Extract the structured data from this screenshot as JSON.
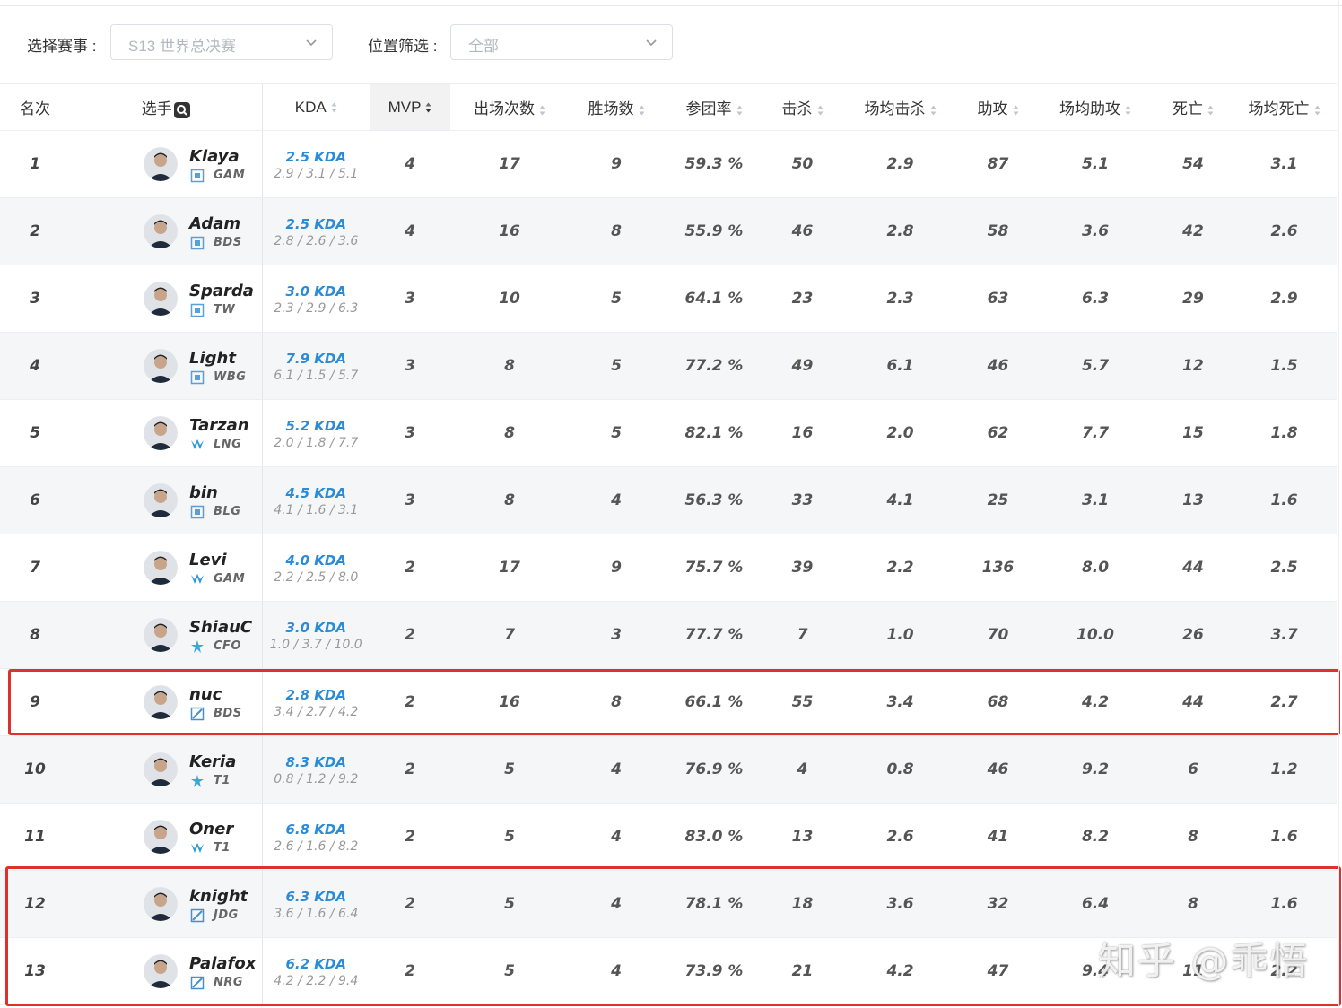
{
  "filters": {
    "event_label": "选择赛事 :",
    "event_value": "S13 世界总决赛",
    "position_label": "位置筛选 :",
    "position_value": "全部"
  },
  "columns": {
    "rank": "名次",
    "player": "选手",
    "kda": "KDA",
    "mvp": "MVP",
    "games": "出场次数",
    "wins": "胜场数",
    "kp": "参团率",
    "kills": "击杀",
    "avg_kills": "场均击杀",
    "assists": "助攻",
    "avg_assists": "场均助攻",
    "deaths": "死亡",
    "avg_deaths": "场均死亡"
  },
  "colors": {
    "accent": "#2a8bd6",
    "highlight": "#e0302b",
    "row_alt": "#f5f6f8"
  },
  "rows": [
    {
      "rank": "1",
      "name": "Kiaya",
      "team": "GAM",
      "team_icon": "square-logo-icon",
      "kda": "2.5 KDA",
      "kda_detail": "2.9 / 3.1 / 5.1",
      "mvp": "4",
      "games": "17",
      "wins": "9",
      "kp": "59.3 %",
      "kills": "50",
      "avg_kills": "2.9",
      "assists": "87",
      "avg_assists": "5.1",
      "deaths": "54",
      "avg_deaths": "3.1"
    },
    {
      "rank": "2",
      "name": "Adam",
      "team": "BDS",
      "team_icon": "square-logo-icon",
      "kda": "2.5 KDA",
      "kda_detail": "2.8 / 2.6 / 3.6",
      "mvp": "4",
      "games": "16",
      "wins": "8",
      "kp": "55.9 %",
      "kills": "46",
      "avg_kills": "2.8",
      "assists": "58",
      "avg_assists": "3.6",
      "deaths": "42",
      "avg_deaths": "2.6"
    },
    {
      "rank": "3",
      "name": "Sparda",
      "team": "TW",
      "team_icon": "square-logo-icon",
      "kda": "3.0 KDA",
      "kda_detail": "2.3 / 2.9 / 6.3",
      "mvp": "3",
      "games": "10",
      "wins": "5",
      "kp": "64.1 %",
      "kills": "23",
      "avg_kills": "2.3",
      "assists": "63",
      "avg_assists": "6.3",
      "deaths": "29",
      "avg_deaths": "2.9"
    },
    {
      "rank": "4",
      "name": "Light",
      "team": "WBG",
      "team_icon": "square-logo-icon",
      "kda": "7.9 KDA",
      "kda_detail": "6.1 / 1.5 / 5.7",
      "mvp": "3",
      "games": "8",
      "wins": "5",
      "kp": "77.2 %",
      "kills": "49",
      "avg_kills": "6.1",
      "assists": "46",
      "avg_assists": "5.7",
      "deaths": "12",
      "avg_deaths": "1.5"
    },
    {
      "rank": "5",
      "name": "Tarzan",
      "team": "LNG",
      "team_icon": "wings-logo-icon",
      "kda": "5.2 KDA",
      "kda_detail": "2.0 / 1.8 / 7.7",
      "mvp": "3",
      "games": "8",
      "wins": "5",
      "kp": "82.1 %",
      "kills": "16",
      "avg_kills": "2.0",
      "assists": "62",
      "avg_assists": "7.7",
      "deaths": "15",
      "avg_deaths": "1.8"
    },
    {
      "rank": "6",
      "name": "bin",
      "team": "BLG",
      "team_icon": "square-logo-icon",
      "kda": "4.5 KDA",
      "kda_detail": "4.1 / 1.6 / 3.1",
      "mvp": "3",
      "games": "8",
      "wins": "4",
      "kp": "56.3 %",
      "kills": "33",
      "avg_kills": "4.1",
      "assists": "25",
      "avg_assists": "3.1",
      "deaths": "13",
      "avg_deaths": "1.6"
    },
    {
      "rank": "7",
      "name": "Levi",
      "team": "GAM",
      "team_icon": "wings-logo-icon",
      "kda": "4.0 KDA",
      "kda_detail": "2.2 / 2.5 / 8.0",
      "mvp": "2",
      "games": "17",
      "wins": "9",
      "kp": "75.7 %",
      "kills": "39",
      "avg_kills": "2.2",
      "assists": "136",
      "avg_assists": "8.0",
      "deaths": "44",
      "avg_deaths": "2.5"
    },
    {
      "rank": "8",
      "name": "ShiauC",
      "team": "CFO",
      "team_icon": "star-logo-icon",
      "kda": "3.0 KDA",
      "kda_detail": "1.0 / 3.7 / 10.0",
      "mvp": "2",
      "games": "7",
      "wins": "3",
      "kp": "77.7 %",
      "kills": "7",
      "avg_kills": "1.0",
      "assists": "70",
      "avg_assists": "10.0",
      "deaths": "26",
      "avg_deaths": "3.7"
    },
    {
      "rank": "9",
      "name": "nuc",
      "team": "BDS",
      "team_icon": "slash-logo-icon",
      "kda": "2.8 KDA",
      "kda_detail": "3.4 / 2.7 / 4.2",
      "mvp": "2",
      "games": "16",
      "wins": "8",
      "kp": "66.1 %",
      "kills": "55",
      "avg_kills": "3.4",
      "assists": "68",
      "avg_assists": "4.2",
      "deaths": "44",
      "avg_deaths": "2.7"
    },
    {
      "rank": "10",
      "name": "Keria",
      "team": "T1",
      "team_icon": "star-logo-icon",
      "kda": "8.3 KDA",
      "kda_detail": "0.8 / 1.2 / 9.2",
      "mvp": "2",
      "games": "5",
      "wins": "4",
      "kp": "76.9 %",
      "kills": "4",
      "avg_kills": "0.8",
      "assists": "46",
      "avg_assists": "9.2",
      "deaths": "6",
      "avg_deaths": "1.2"
    },
    {
      "rank": "11",
      "name": "Oner",
      "team": "T1",
      "team_icon": "wings-logo-icon",
      "kda": "6.8 KDA",
      "kda_detail": "2.6 / 1.6 / 8.2",
      "mvp": "2",
      "games": "5",
      "wins": "4",
      "kp": "83.0 %",
      "kills": "13",
      "avg_kills": "2.6",
      "assists": "41",
      "avg_assists": "8.2",
      "deaths": "8",
      "avg_deaths": "1.6"
    },
    {
      "rank": "12",
      "name": "knight",
      "team": "JDG",
      "team_icon": "slash-logo-icon",
      "kda": "6.3 KDA",
      "kda_detail": "3.6 / 1.6 / 6.4",
      "mvp": "2",
      "games": "5",
      "wins": "4",
      "kp": "78.1 %",
      "kills": "18",
      "avg_kills": "3.6",
      "assists": "32",
      "avg_assists": "6.4",
      "deaths": "8",
      "avg_deaths": "1.6"
    },
    {
      "rank": "13",
      "name": "Palafox",
      "team": "NRG",
      "team_icon": "slash-logo-icon",
      "kda": "6.2 KDA",
      "kda_detail": "4.2 / 2.2 / 9.4",
      "mvp": "2",
      "games": "5",
      "wins": "4",
      "kp": "73.9 %",
      "kills": "21",
      "avg_kills": "4.2",
      "assists": "47",
      "avg_assists": "9.4",
      "deaths": "11",
      "avg_deaths": "2.2"
    }
  ],
  "watermark": "知乎 @乖悟"
}
